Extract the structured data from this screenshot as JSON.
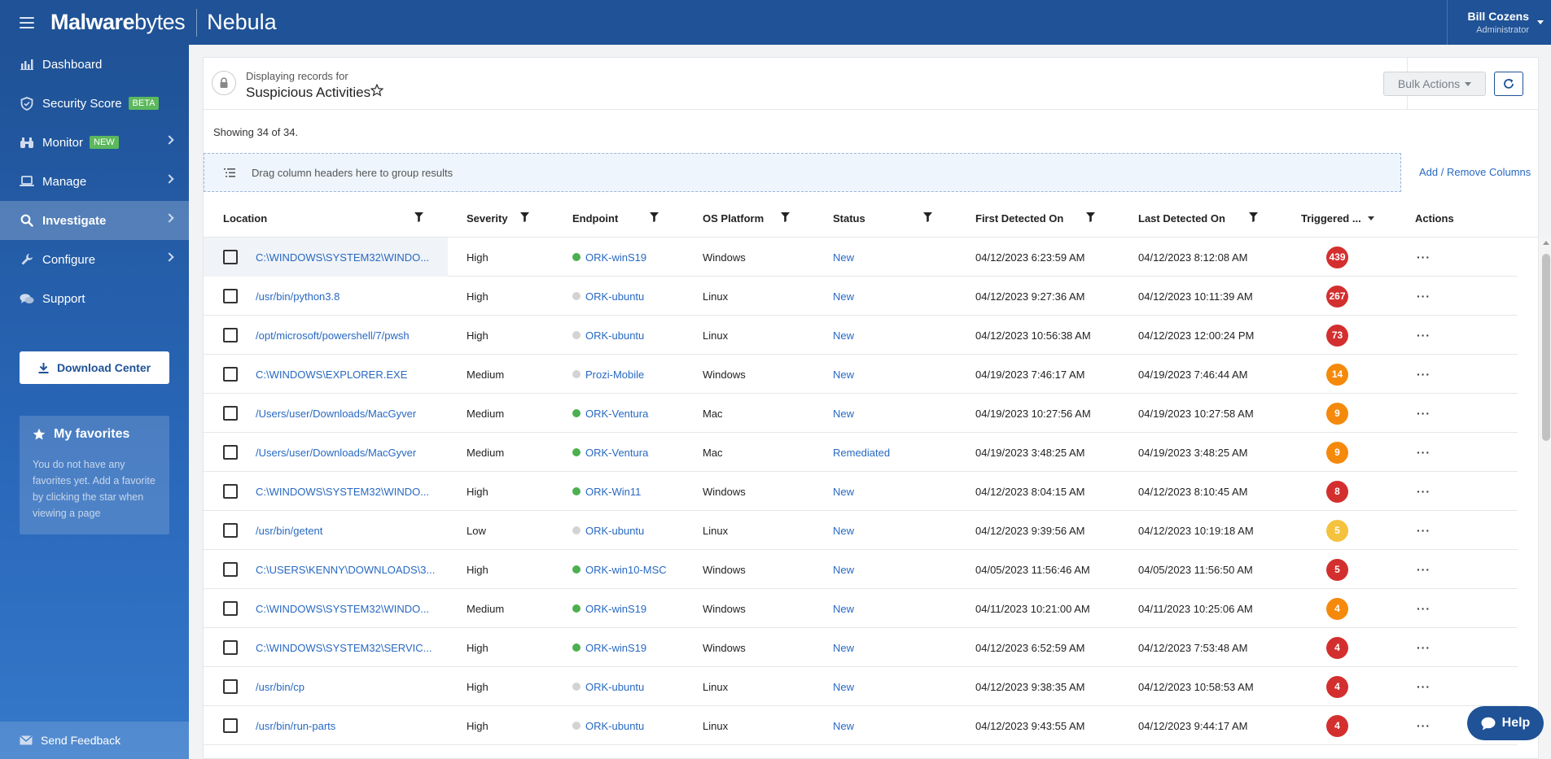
{
  "topbar": {
    "logo_bold": "Malware",
    "logo_thin": "bytes",
    "product": "Nebula",
    "user_name": "Bill Cozens",
    "user_role": "Administrator"
  },
  "sidebar": {
    "items": [
      {
        "label": "Dashboard",
        "icon": "bar-chart-icon"
      },
      {
        "label": "Security Score",
        "icon": "shield-icon",
        "badge": "BETA"
      },
      {
        "label": "Monitor",
        "icon": "binoculars-icon",
        "badge": "NEW"
      },
      {
        "label": "Manage",
        "icon": "laptop-icon"
      },
      {
        "label": "Investigate",
        "icon": "search-icon"
      },
      {
        "label": "Configure",
        "icon": "wrench-icon"
      },
      {
        "label": "Support",
        "icon": "chat-icon"
      }
    ],
    "download_label": "Download Center",
    "favorites_title": "My favorites",
    "favorites_text": "You do not have any favorites yet. Add a favorite by clicking the star when viewing a page",
    "feedback_label": "Send Feedback"
  },
  "page": {
    "displaying_label": "Displaying records for",
    "title": "Suspicious Activities",
    "bulk_actions": "Bulk Actions",
    "showing": "Showing 34 of 34.",
    "group_hint": "Drag column headers here to group results",
    "add_remove_columns": "Add / Remove Columns",
    "help": "Help"
  },
  "columns": {
    "location": "Location",
    "severity": "Severity",
    "endpoint": "Endpoint",
    "os": "OS Platform",
    "status": "Status",
    "first": "First Detected On",
    "last": "Last Detected On",
    "triggered": "Triggered ...",
    "actions": "Actions"
  },
  "colors": {
    "red": "#d32f2f",
    "orange": "#f5890b",
    "yellow": "#f4c23d",
    "online": "#4caf50",
    "offline": "#d3d3d3"
  },
  "rows": [
    {
      "location": "C:\\WINDOWS\\SYSTEM32\\WINDO...",
      "severity": "High",
      "endpoint": "ORK-winS19",
      "online": true,
      "os": "Windows",
      "status": "New",
      "first": "04/12/2023 6:23:59 AM",
      "last": "04/12/2023 8:12:08 AM",
      "triggered": "439",
      "color": "#d32f2f"
    },
    {
      "location": "/usr/bin/python3.8",
      "severity": "High",
      "endpoint": "ORK-ubuntu",
      "online": false,
      "os": "Linux",
      "status": "New",
      "first": "04/12/2023 9:27:36 AM",
      "last": "04/12/2023 10:11:39 AM",
      "triggered": "267",
      "color": "#d32f2f"
    },
    {
      "location": "/opt/microsoft/powershell/7/pwsh",
      "severity": "High",
      "endpoint": "ORK-ubuntu",
      "online": false,
      "os": "Linux",
      "status": "New",
      "first": "04/12/2023 10:56:38 AM",
      "last": "04/12/2023 12:00:24 PM",
      "triggered": "73",
      "color": "#d32f2f"
    },
    {
      "location": "C:\\WINDOWS\\EXPLORER.EXE",
      "severity": "Medium",
      "endpoint": "Prozi-Mobile",
      "online": false,
      "os": "Windows",
      "status": "New",
      "first": "04/19/2023 7:46:17 AM",
      "last": "04/19/2023 7:46:44 AM",
      "triggered": "14",
      "color": "#f5890b"
    },
    {
      "location": "/Users/user/Downloads/MacGyver",
      "severity": "Medium",
      "endpoint": "ORK-Ventura",
      "online": true,
      "os": "Mac",
      "status": "New",
      "first": "04/19/2023 10:27:56 AM",
      "last": "04/19/2023 10:27:58 AM",
      "triggered": "9",
      "color": "#f5890b"
    },
    {
      "location": "/Users/user/Downloads/MacGyver",
      "severity": "Medium",
      "endpoint": "ORK-Ventura",
      "online": true,
      "os": "Mac",
      "status": "Remediated",
      "first": "04/19/2023 3:48:25 AM",
      "last": "04/19/2023 3:48:25 AM",
      "triggered": "9",
      "color": "#f5890b"
    },
    {
      "location": "C:\\WINDOWS\\SYSTEM32\\WINDO...",
      "severity": "High",
      "endpoint": "ORK-Win11",
      "online": true,
      "os": "Windows",
      "status": "New",
      "first": "04/12/2023 8:04:15 AM",
      "last": "04/12/2023 8:10:45 AM",
      "triggered": "8",
      "color": "#d32f2f"
    },
    {
      "location": "/usr/bin/getent",
      "severity": "Low",
      "endpoint": "ORK-ubuntu",
      "online": false,
      "os": "Linux",
      "status": "New",
      "first": "04/12/2023 9:39:56 AM",
      "last": "04/12/2023 10:19:18 AM",
      "triggered": "5",
      "color": "#f4c23d"
    },
    {
      "location": "C:\\USERS\\KENNY\\DOWNLOADS\\3...",
      "severity": "High",
      "endpoint": "ORK-win10-MSC",
      "online": true,
      "os": "Windows",
      "status": "New",
      "first": "04/05/2023 11:56:46 AM",
      "last": "04/05/2023 11:56:50 AM",
      "triggered": "5",
      "color": "#d32f2f"
    },
    {
      "location": "C:\\WINDOWS\\SYSTEM32\\WINDO...",
      "severity": "Medium",
      "endpoint": "ORK-winS19",
      "online": true,
      "os": "Windows",
      "status": "New",
      "first": "04/11/2023 10:21:00 AM",
      "last": "04/11/2023 10:25:06 AM",
      "triggered": "4",
      "color": "#f5890b"
    },
    {
      "location": "C:\\WINDOWS\\SYSTEM32\\SERVIC...",
      "severity": "High",
      "endpoint": "ORK-winS19",
      "online": true,
      "os": "Windows",
      "status": "New",
      "first": "04/12/2023 6:52:59 AM",
      "last": "04/12/2023 7:53:48 AM",
      "triggered": "4",
      "color": "#d32f2f"
    },
    {
      "location": "/usr/bin/cp",
      "severity": "High",
      "endpoint": "ORK-ubuntu",
      "online": false,
      "os": "Linux",
      "status": "New",
      "first": "04/12/2023 9:38:35 AM",
      "last": "04/12/2023 10:58:53 AM",
      "triggered": "4",
      "color": "#d32f2f"
    },
    {
      "location": "/usr/bin/run-parts",
      "severity": "High",
      "endpoint": "ORK-ubuntu",
      "online": false,
      "os": "Linux",
      "status": "New",
      "first": "04/12/2023 9:43:55 AM",
      "last": "04/12/2023 9:44:17 AM",
      "triggered": "4",
      "color": "#d32f2f"
    }
  ]
}
